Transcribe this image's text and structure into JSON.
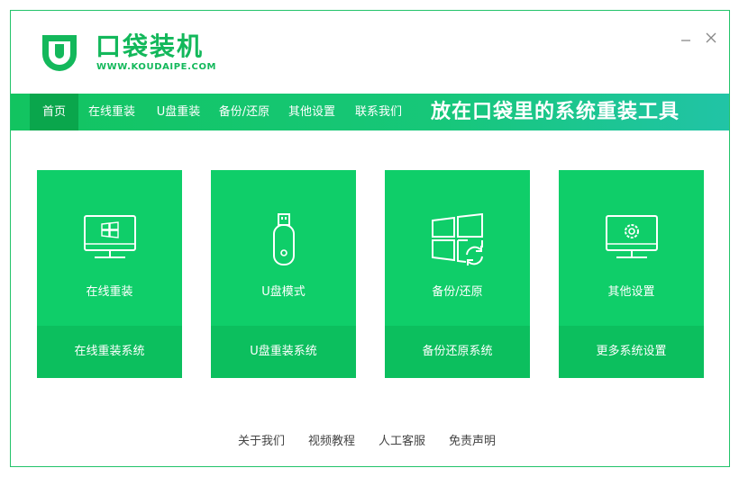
{
  "app": {
    "name": "口袋装机",
    "domain": "WWW.KOUDAIPE.COM",
    "brand_color": "#13b85b"
  },
  "window_controls": [
    "minimize-icon",
    "close-icon"
  ],
  "nav": {
    "items": [
      {
        "label": "首页",
        "active": true
      },
      {
        "label": "在线重装",
        "active": false
      },
      {
        "label": "U盘重装",
        "active": false
      },
      {
        "label": "备份/还原",
        "active": false
      },
      {
        "label": "其他设置",
        "active": false
      },
      {
        "label": "联系我们",
        "active": false
      }
    ],
    "slogan": "放在口袋里的系统重装工具"
  },
  "cards": [
    {
      "icon": "monitor-windows-icon",
      "title": "在线重装",
      "action": "在线重装系统"
    },
    {
      "icon": "usb-drive-icon",
      "title": "U盘模式",
      "action": "U盘重装系统"
    },
    {
      "icon": "windows-restore-icon",
      "title": "备份/还原",
      "action": "备份还原系统"
    },
    {
      "icon": "monitor-gear-icon",
      "title": "其他设置",
      "action": "更多系统设置"
    }
  ],
  "colors": {
    "card": "#0fce69",
    "card_bottom": "#0cbf5e",
    "nav_active": "#0aa64c"
  },
  "footer": {
    "links": [
      "关于我们",
      "视频教程",
      "人工客服",
      "免责声明"
    ]
  }
}
